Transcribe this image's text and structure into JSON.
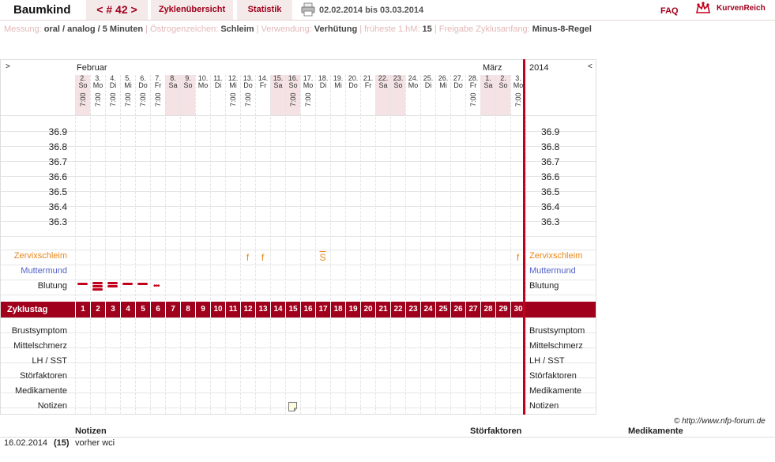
{
  "app": {
    "name": "Baumkind"
  },
  "nav": {
    "cycle_label": "< # 42 >",
    "overview": "Zyklenübersicht",
    "stats": "Statistik",
    "range": "02.02.2014 bis 03.03.2014",
    "faq": "FAQ",
    "logo_text": "KurvenReich"
  },
  "settings": {
    "messung_label": "Messung:",
    "messung_value": "oral / analog / 5 Minuten",
    "oestrogen_label": "Östrogenzeichen:",
    "oestrogen_value": "Schleim",
    "verwendung_label": "Verwendung:",
    "verwendung_value": "Verhütung",
    "fruehest_label": "früheste 1.hM:",
    "fruehest_value": "15",
    "freigabe_label": "Freigabe Zyklusanfang:",
    "freigabe_value": "Minus-8-Regel"
  },
  "grid": {
    "left_arrow": ">",
    "right_arrow": "<",
    "month1": "Februar",
    "month2": "März",
    "year": "2014",
    "days": [
      {
        "d": "2.",
        "w": "So",
        "t": "7:00",
        "we": true
      },
      {
        "d": "3.",
        "w": "Mo",
        "t": "7:00",
        "we": false
      },
      {
        "d": "4.",
        "w": "Di",
        "t": "7:00",
        "we": false
      },
      {
        "d": "5.",
        "w": "Mi",
        "t": "7:00",
        "we": false
      },
      {
        "d": "6.",
        "w": "Do",
        "t": "7:00",
        "we": false
      },
      {
        "d": "7.",
        "w": "Fr",
        "t": "7:00",
        "we": false
      },
      {
        "d": "8.",
        "w": "Sa",
        "t": "",
        "we": true
      },
      {
        "d": "9.",
        "w": "So",
        "t": "",
        "we": true
      },
      {
        "d": "10.",
        "w": "Mo",
        "t": "",
        "we": false
      },
      {
        "d": "11.",
        "w": "Di",
        "t": "",
        "we": false
      },
      {
        "d": "12.",
        "w": "Mi",
        "t": "7:00",
        "we": false
      },
      {
        "d": "13.",
        "w": "Do",
        "t": "7:00",
        "we": false
      },
      {
        "d": "14.",
        "w": "Fr",
        "t": "",
        "we": false
      },
      {
        "d": "15.",
        "w": "Sa",
        "t": "",
        "we": true
      },
      {
        "d": "16.",
        "w": "So",
        "t": "7:00",
        "we": true
      },
      {
        "d": "17.",
        "w": "Mo",
        "t": "7:00",
        "we": false
      },
      {
        "d": "18.",
        "w": "Di",
        "t": "",
        "we": false
      },
      {
        "d": "19.",
        "w": "Mi",
        "t": "",
        "we": false
      },
      {
        "d": "20.",
        "w": "Do",
        "t": "",
        "we": false
      },
      {
        "d": "21.",
        "w": "Fr",
        "t": "",
        "we": false
      },
      {
        "d": "22.",
        "w": "Sa",
        "t": "",
        "we": true
      },
      {
        "d": "23.",
        "w": "So",
        "t": "",
        "we": true
      },
      {
        "d": "24.",
        "w": "Mo",
        "t": "",
        "we": false
      },
      {
        "d": "25.",
        "w": "Di",
        "t": "",
        "we": false
      },
      {
        "d": "26.",
        "w": "Mi",
        "t": "",
        "we": false
      },
      {
        "d": "27.",
        "w": "Do",
        "t": "",
        "we": false
      },
      {
        "d": "28.",
        "w": "Fr",
        "t": "7:00",
        "we": false
      },
      {
        "d": "1.",
        "w": "Sa",
        "t": "",
        "we": true
      },
      {
        "d": "2.",
        "w": "So",
        "t": "",
        "we": true
      },
      {
        "d": "3.",
        "w": "Mo",
        "t": "7:00",
        "we": false
      }
    ],
    "temps": [
      "36.9",
      "36.8",
      "36.7",
      "36.6",
      "36.5",
      "36.4",
      "36.3"
    ],
    "rows": {
      "zervix": "Zervixschleim",
      "muttermund": "Muttermund",
      "blutung": "Blutung",
      "zyklustag": "Zyklustag",
      "brust": "Brustsymptom",
      "mittel": "Mittelschmerz",
      "lh": "LH / SST",
      "stoer": "Störfaktoren",
      "medi": "Medikamente",
      "notizen": "Notizen"
    },
    "zervix_marks": [
      {
        "day": 12,
        "sym": "f"
      },
      {
        "day": 13,
        "sym": "f"
      },
      {
        "day": 17,
        "sym": "S"
      },
      {
        "day": 30,
        "sym": "f"
      }
    ],
    "bleeding": [
      {
        "day": 1,
        "level": "medium"
      },
      {
        "day": 2,
        "level": "heavy"
      },
      {
        "day": 3,
        "level": "strong"
      },
      {
        "day": 4,
        "level": "medium"
      },
      {
        "day": 5,
        "level": "medium"
      },
      {
        "day": 6,
        "level": "spotting"
      }
    ],
    "note_day": 15
  },
  "colors": {
    "accent": "#a0001c",
    "zervix": "#e8861a",
    "muttermund": "#5060c8"
  },
  "copyright": "© http://www.nfp-forum.de",
  "notes_table": {
    "col_notes": "Notizen",
    "col_stoer": "Störfaktoren",
    "col_medi": "Medikamente",
    "rows": [
      {
        "date": "16.02.2014",
        "day": "(15)",
        "text": "vorher wci"
      }
    ]
  }
}
